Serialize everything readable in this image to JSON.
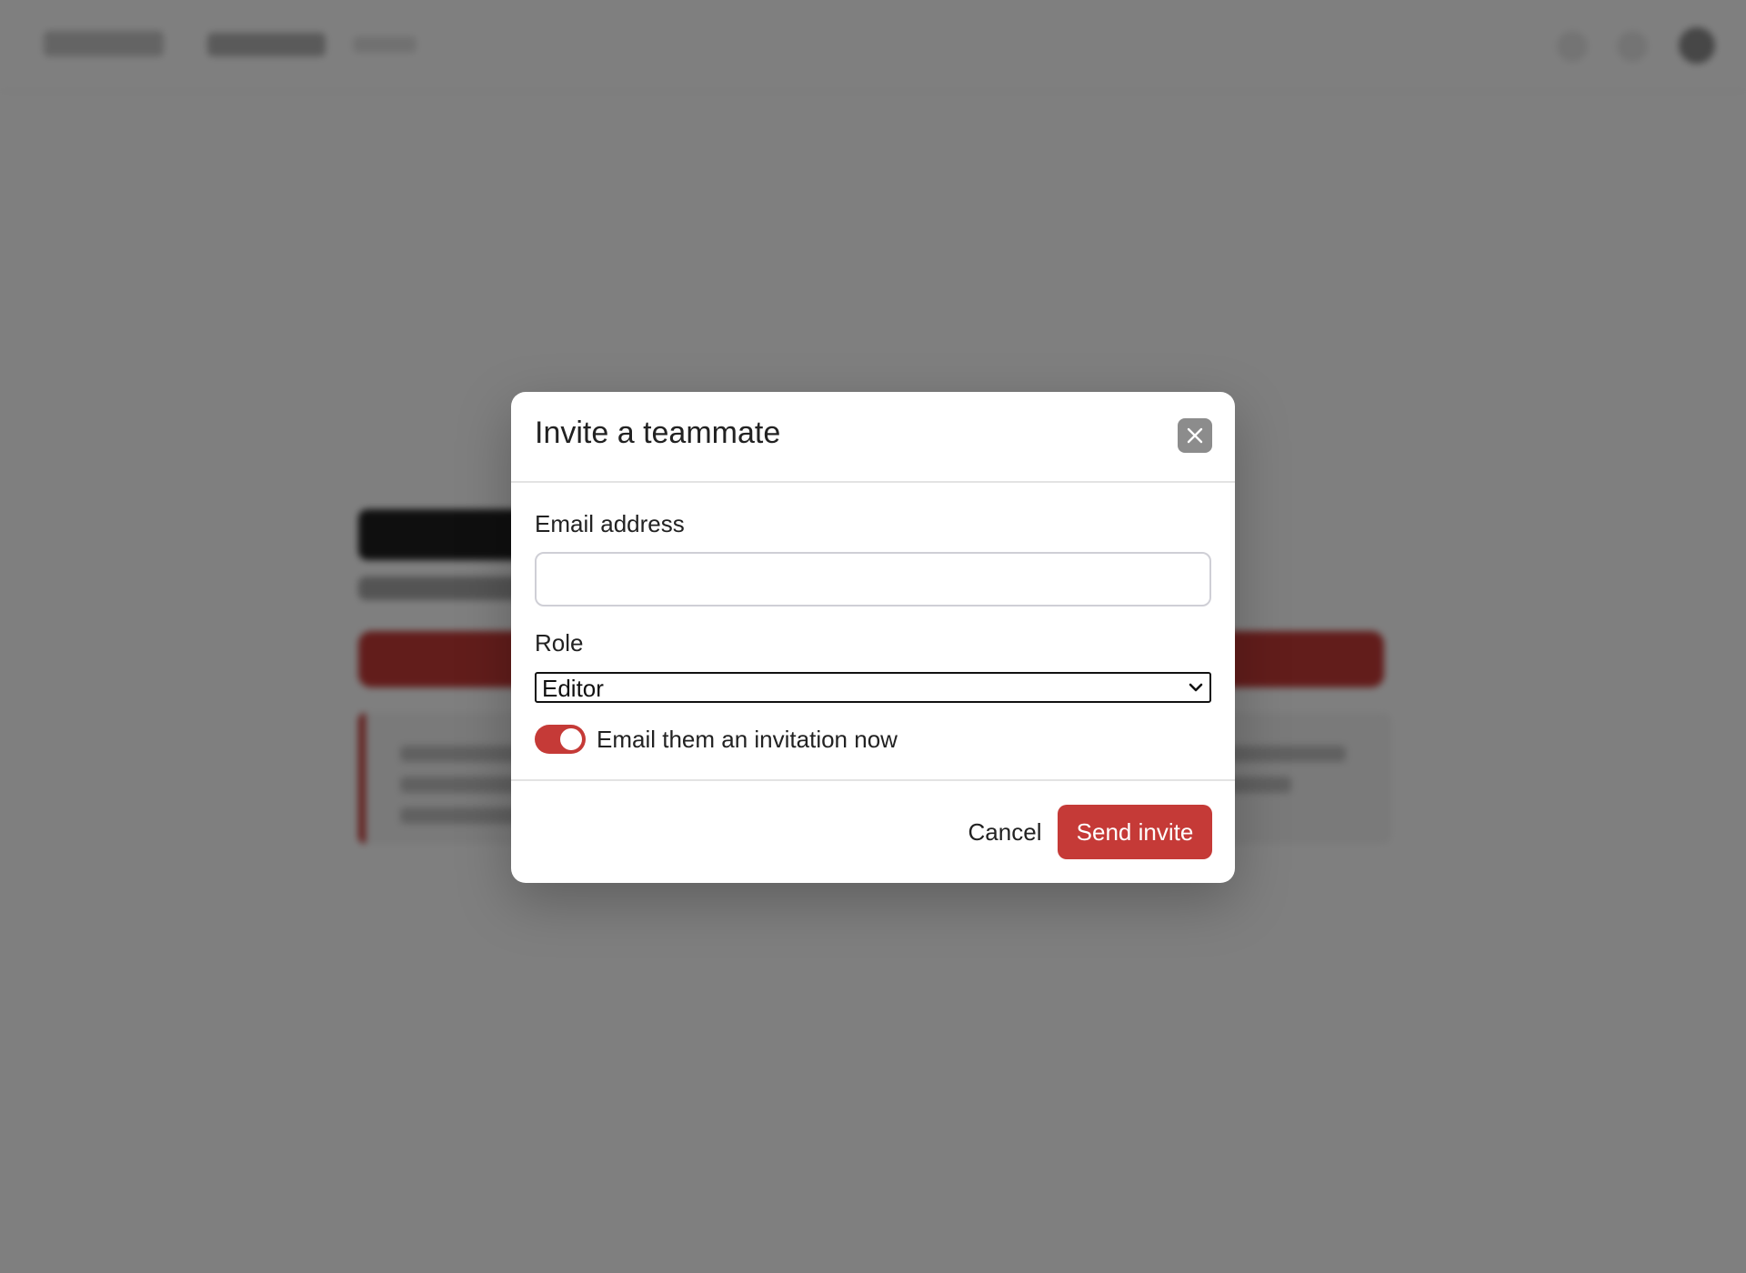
{
  "modal": {
    "title": "Invite a teammate",
    "close_icon": "close-icon",
    "email": {
      "label": "Email address",
      "value": "",
      "placeholder": ""
    },
    "role": {
      "label": "Role",
      "selected": "Editor",
      "chevron_icon": "chevron-down-icon"
    },
    "invite_toggle": {
      "label": "Email them an invitation now",
      "on": true
    },
    "footer": {
      "cancel_label": "Cancel",
      "send_label": "Send invite"
    }
  },
  "colors": {
    "accent": "#c53a37",
    "overlay": "rgba(0,0,0,0.5)",
    "close_button": "#8c8c8c"
  }
}
